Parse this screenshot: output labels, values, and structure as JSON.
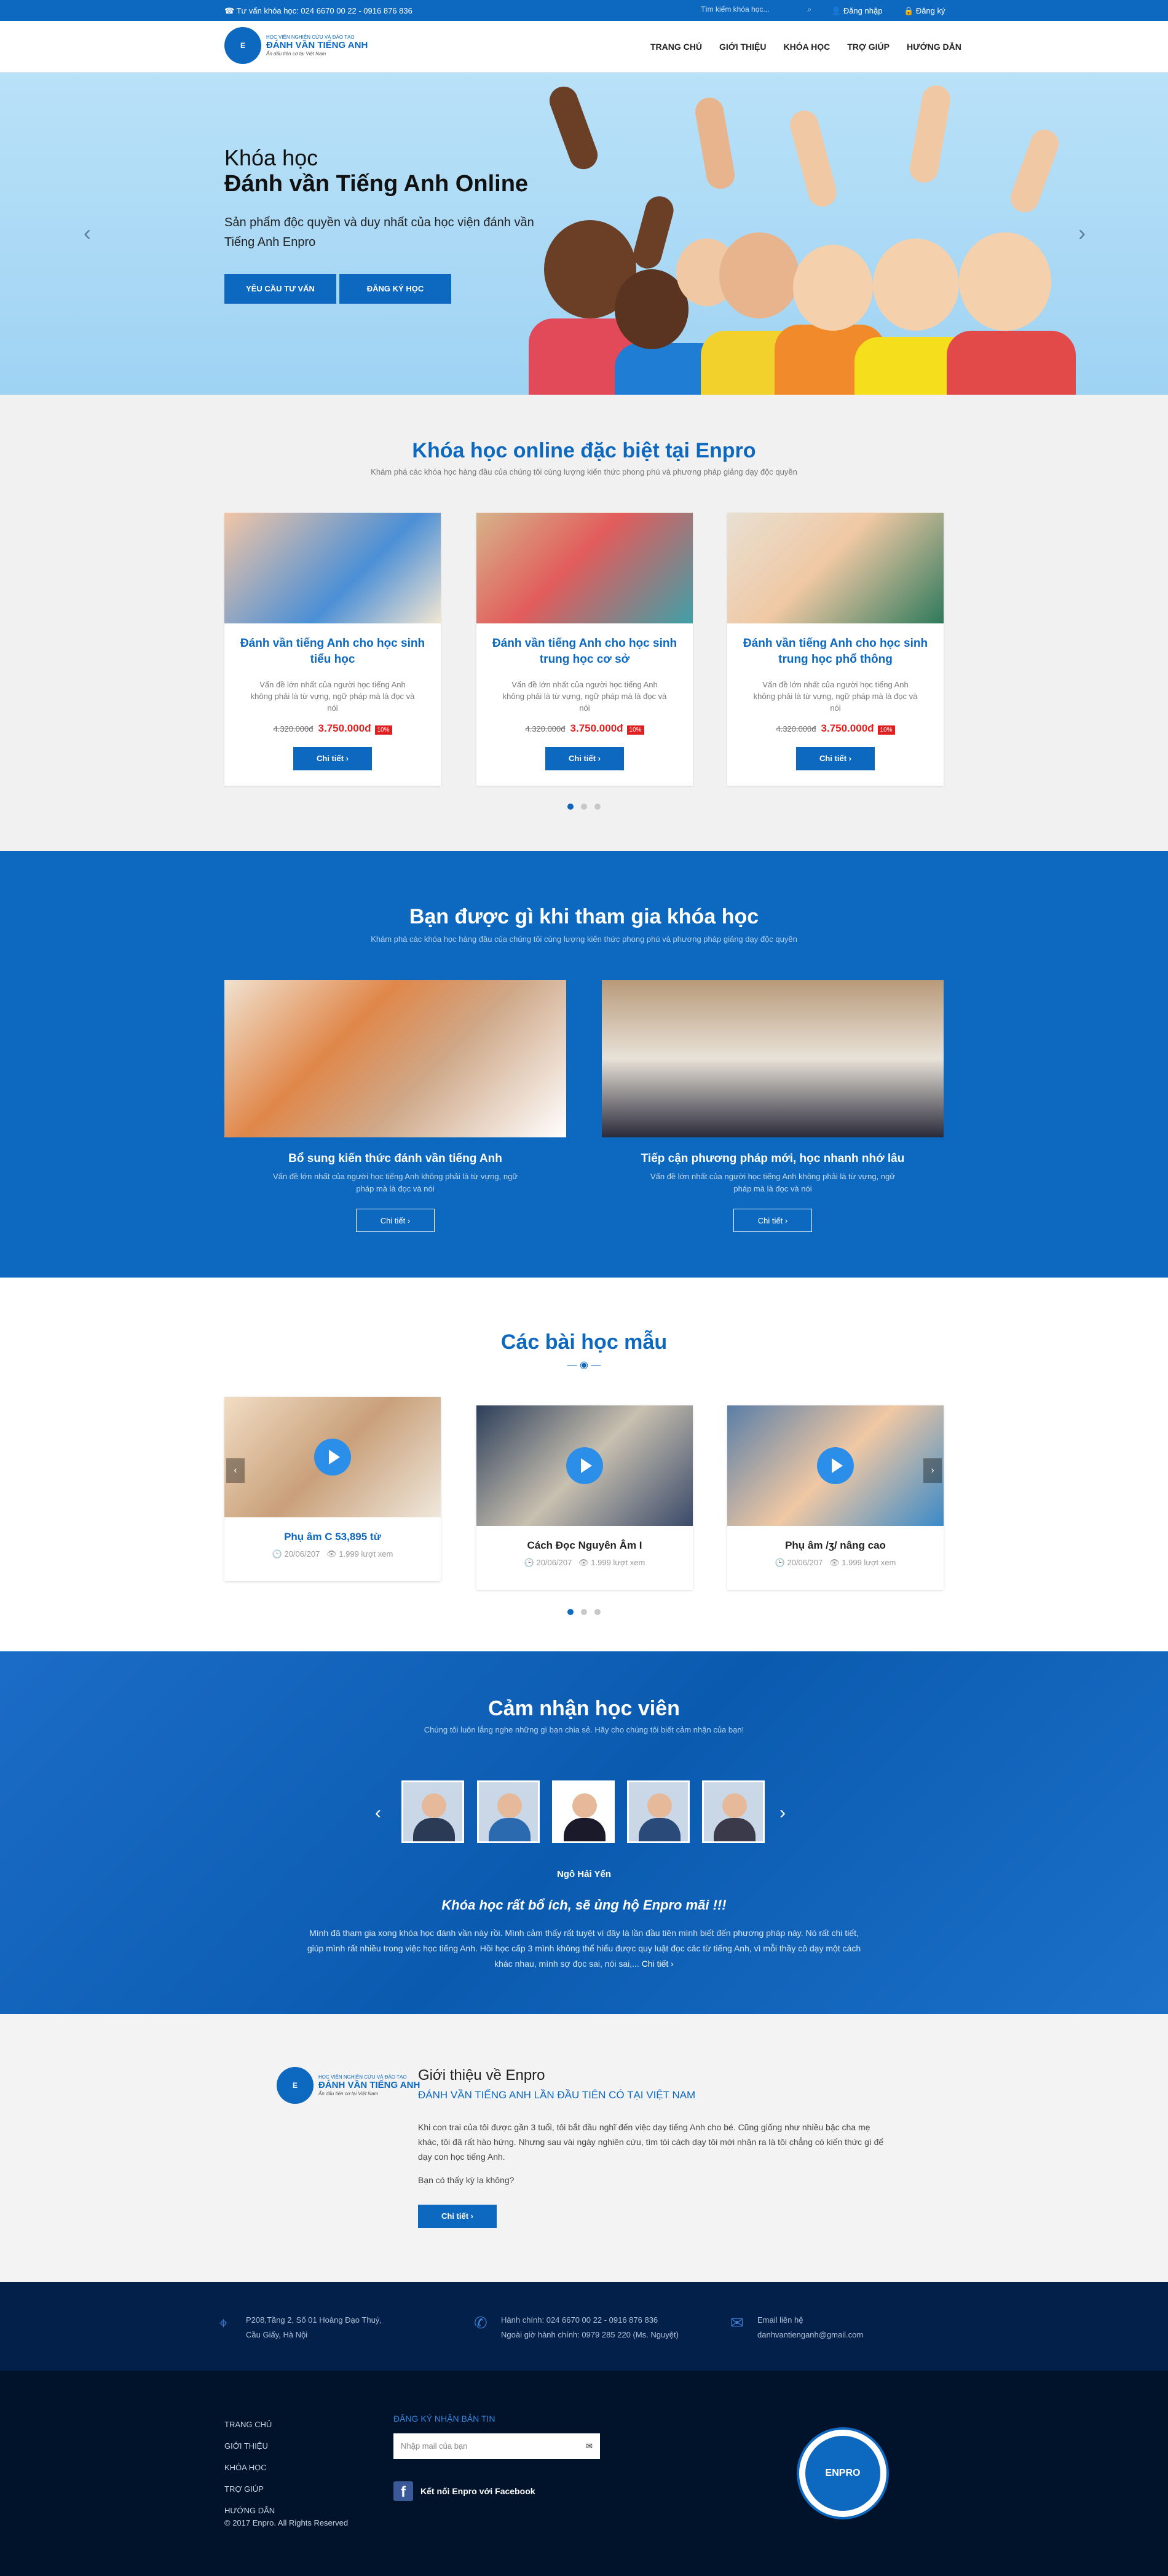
{
  "topbar": {
    "hotline": "Tư vấn khóa học: 024 6670 00 22 - 0916 876 836",
    "search_placeholder": "Tìm kiếm khóa học...",
    "login": "Đăng nhập",
    "register": "Đăng ký"
  },
  "logo": {
    "line1": "HỌC VIỆN NGHIÊN CỨU VÀ ĐÀO TẠO",
    "line2": "ĐÁNH VẦN TIẾNG ANH",
    "line3": "Ấn dấu tiên cơ tại Việt Nam"
  },
  "nav": [
    "TRANG CHỦ",
    "GIỚI THIỆU",
    "KHÓA HỌC",
    "TRỢ GIÚP",
    "HƯỚNG DẪN"
  ],
  "hero": {
    "subtitle": "Khóa học",
    "title": "Đánh vần Tiếng Anh Online",
    "desc": "Sản phẩm độc quyền và duy nhất của học viện đánh vần Tiếng Anh Enpro",
    "btn_consult": "YÊU CẦU TƯ VẤN",
    "btn_register": "ĐĂNG KÝ HỌC"
  },
  "courses": {
    "title": "Khóa học online đặc biệt tại Enpro",
    "subtitle": "Khám phá các khóa học hàng đầu của chúng tôi cùng lượng kiến thức phong phú và phương pháp giảng dạy độc quyền",
    "items": [
      {
        "title": "Đánh vần tiếng Anh cho học sinh tiểu học",
        "desc": "Vấn đề lớn nhất của người học tiếng Anh không phải là từ vựng, ngữ pháp mà là đọc và nói",
        "old_price": "4.320.000đ",
        "new_price": "3.750.000đ",
        "discount": "10%",
        "button": "Chi tiết"
      },
      {
        "title": "Đánh vần tiếng Anh cho học sinh trung học cơ sở",
        "desc": "Vấn đề lớn nhất của người học tiếng Anh không phải là từ vựng, ngữ pháp mà là đọc và nói",
        "old_price": "4.320.000đ",
        "new_price": "3.750.000đ",
        "discount": "10%",
        "button": "Chi tiết"
      },
      {
        "title": "Đánh vần tiếng Anh cho học sinh trung học phổ thông",
        "desc": "Vấn đề lớn nhất của người học tiếng Anh không phải là từ vựng, ngữ pháp mà là đọc và nói",
        "old_price": "4.320.000đ",
        "new_price": "3.750.000đ",
        "discount": "10%",
        "button": "Chi tiết"
      }
    ]
  },
  "benefits": {
    "title": "Bạn được gì khi tham gia khóa học",
    "subtitle": "Khám phá các khóa học hàng đầu của chúng tôi cùng lượng kiến thức phong phú và phương pháp giảng dạy độc quyền",
    "items": [
      {
        "title": "Bổ sung kiến thức đánh vần tiếng Anh",
        "desc": "Vấn đề lớn nhất của người học tiếng Anh không phải là từ vựng, ngữ pháp mà là đọc và nói",
        "button": "Chi tiết"
      },
      {
        "title": "Tiếp cận phương pháp mới, học nhanh nhớ lâu",
        "desc": "Vấn đề lớn nhất của người học tiếng Anh không phải là từ vựng, ngữ pháp mà là đọc và nói",
        "button": "Chi tiết"
      }
    ]
  },
  "lessons": {
    "title": "Các bài học mẫu",
    "items": [
      {
        "title": "Phụ âm C 53,895 từ",
        "date": "20/06/207",
        "views": "1.999 lượt xem"
      },
      {
        "title": "Cách Đọc Nguyên Âm I",
        "date": "20/06/207",
        "views": "1.999 lượt xem"
      },
      {
        "title": "Phụ âm /ʒ/ nâng cao",
        "date": "20/06/207",
        "views": "1.999 lượt xem"
      }
    ]
  },
  "testimonials": {
    "title": "Cảm nhận học viên",
    "subtitle": "Chúng tôi luôn lắng nghe những gì bạn chia sẻ. Hãy cho chúng tôi biết cảm nhận của bạn!",
    "name": "Ngô Hải Yến",
    "quote": "Khóa học rất bổ ích, sẽ ủng hộ Enpro mãi !!!",
    "body": "Mình đã tham gia xong khóa học đánh vần này rồi. Mình cảm thấy rất tuyệt vì đây là lần đầu tiên mình biết đến phương pháp này. Nó rất chi tiết, giúp mình rất nhiều trong việc học tiếng Anh. Hồi học cấp 3 mình không thể hiểu được quy luật đọc các từ tiếng Anh, vì mỗi thầy cô dạy một cách khác nhau, mình sợ đọc sai, nói sai,...",
    "more": "Chi tiết"
  },
  "about": {
    "title": "Giới thiệu về Enpro",
    "subtitle": "ĐÁNH VẦN TIẾNG ANH LẦN ĐẦU TIÊN CÓ TẠI VIỆT NAM",
    "paragraph": "Khi con trai của tôi được gần 3 tuổi, tôi bắt đầu nghĩ đến việc dạy tiếng Anh cho bé. Cũng giống như nhiều bậc cha mẹ khác, tôi đã rất hào hứng. Nhưng sau vài ngày nghiên cứu, tìm tòi cách dạy tôi mới nhận ra là tôi chẳng có kiến thức gì để dạy con học tiếng Anh.",
    "question": "Bạn có thấy kỳ lạ không?",
    "button": "Chi tiết"
  },
  "contact": {
    "address": [
      "P208,Tầng 2, Số 01 Hoàng Đạo Thuý,",
      "Cầu Giấy, Hà Nội"
    ],
    "phone": [
      "Hành chính: 024 6670 00 22 - 0916 876 836",
      "Ngoài giờ hành chính: 0979 285 220 (Ms. Nguyệt)"
    ],
    "email": [
      "Email liên hệ",
      "danhvantienganh@gmail.com"
    ]
  },
  "footer": {
    "nav": [
      "TRANG CHỦ",
      "GIỚI THIỆU",
      "KHÓA HỌC",
      "TRỢ GIÚP",
      "HƯỚNG DẪN"
    ],
    "copyright": "© 2017 Enpro. All Rights Reserved",
    "newsletter_title": "ĐĂNG KÝ NHẬN BẢN TIN",
    "email_placeholder": "Nhập mail của bạn",
    "facebook": "Kết nối Enpro với Facebook",
    "seal_text": "ENPRO"
  },
  "colors": {
    "primary": "#0d68c0",
    "dark": "#01132b",
    "sale": "#e02020"
  }
}
